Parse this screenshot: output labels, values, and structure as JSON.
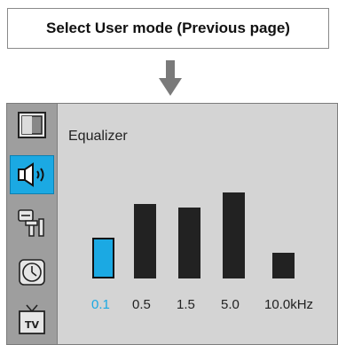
{
  "caption": "Select User mode (Previous page)",
  "osd": {
    "title": "Equalizer",
    "menu_icons": [
      {
        "name": "picture-icon",
        "active": false
      },
      {
        "name": "sound-icon",
        "active": true
      },
      {
        "name": "setup-icon",
        "active": false
      },
      {
        "name": "clock-icon",
        "active": false
      },
      {
        "name": "tv-icon",
        "active": false
      }
    ],
    "accent_color": "#1ba9e3"
  },
  "equalizer": {
    "bands": [
      {
        "label": "0.1",
        "level": 0.45,
        "selected": true
      },
      {
        "label": "0.5",
        "level": 0.82,
        "selected": false
      },
      {
        "label": "1.5",
        "level": 0.78,
        "selected": false
      },
      {
        "label": "5.0",
        "level": 0.95,
        "selected": false
      },
      {
        "label": "10.0kHz",
        "level": 0.28,
        "selected": false
      }
    ]
  }
}
